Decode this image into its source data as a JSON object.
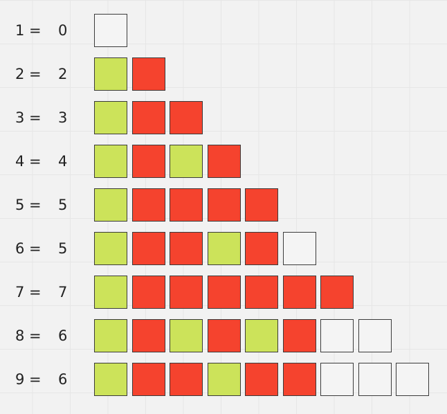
{
  "colors": {
    "green": "#cce35a",
    "red": "#f5432e",
    "empty": "#f4f4f4",
    "border": "#3a3a3a",
    "background": "#f2f2f2"
  },
  "rows": [
    {
      "label": "1 =",
      "value": "0",
      "cells": [
        "empty"
      ]
    },
    {
      "label": "2 =",
      "value": "2",
      "cells": [
        "green",
        "red"
      ]
    },
    {
      "label": "3 =",
      "value": "3",
      "cells": [
        "green",
        "red",
        "red"
      ]
    },
    {
      "label": "4 =",
      "value": "4",
      "cells": [
        "green",
        "red",
        "green",
        "red"
      ]
    },
    {
      "label": "5 =",
      "value": "5",
      "cells": [
        "green",
        "red",
        "red",
        "red",
        "red"
      ]
    },
    {
      "label": "6 =",
      "value": "5",
      "cells": [
        "green",
        "red",
        "red",
        "green",
        "red",
        "empty"
      ]
    },
    {
      "label": "7 =",
      "value": "7",
      "cells": [
        "green",
        "red",
        "red",
        "red",
        "red",
        "red",
        "red"
      ]
    },
    {
      "label": "8 =",
      "value": "6",
      "cells": [
        "green",
        "red",
        "green",
        "red",
        "green",
        "red",
        "empty",
        "empty"
      ]
    },
    {
      "label": "9 =",
      "value": "6",
      "cells": [
        "green",
        "red",
        "red",
        "green",
        "red",
        "red",
        "empty",
        "empty",
        "empty"
      ]
    }
  ]
}
